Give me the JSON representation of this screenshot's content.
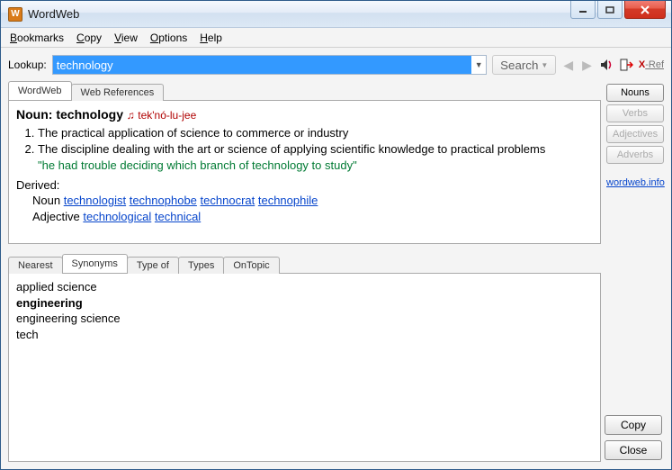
{
  "title": "WordWeb",
  "menu": {
    "bookmarks": "Bookmarks",
    "copy": "Copy",
    "view": "View",
    "options": "Options",
    "help": "Help"
  },
  "lookup": {
    "label": "Lookup:",
    "value": "technology",
    "search": "Search"
  },
  "toolbar": {
    "xref": "X-Ref"
  },
  "tabs": {
    "main": [
      "WordWeb",
      "Web References"
    ],
    "lower": [
      "Nearest",
      "Synonyms",
      "Type of",
      "Types",
      "OnTopic"
    ]
  },
  "pos_buttons": {
    "nouns": "Nouns",
    "verbs": "Verbs",
    "adjectives": "Adjectives",
    "adverbs": "Adverbs"
  },
  "sidebar_link": "wordweb.info",
  "definition": {
    "pos_word": "Noun:",
    "headword": "technology",
    "pronunciation": "tek'nó-lu-jee",
    "senses": [
      {
        "text": "The practical application of science to commerce or industry"
      },
      {
        "text": "The discipline dealing with the art or science of applying scientific knowledge to practical problems",
        "example": "\"he had trouble deciding which branch of technology to study\""
      }
    ],
    "derived_label": "Derived:",
    "derived": [
      {
        "pos": "Noun",
        "words": [
          "technologist",
          "technophobe",
          "technocrat",
          "technophile"
        ]
      },
      {
        "pos": "Adjective",
        "words": [
          "technological",
          "technical"
        ]
      }
    ]
  },
  "synonyms": [
    "applied science",
    "engineering",
    "engineering science",
    "tech"
  ],
  "synonyms_bold_index": 1,
  "buttons": {
    "copy": "Copy",
    "close": "Close"
  }
}
